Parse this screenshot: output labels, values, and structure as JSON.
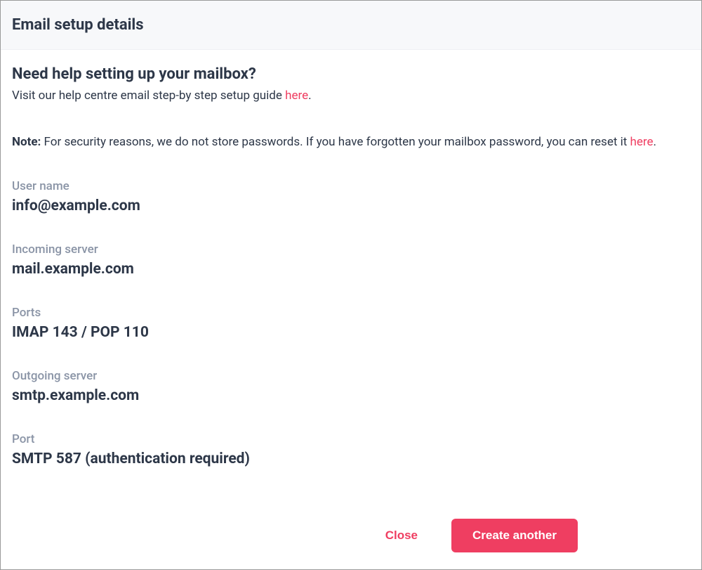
{
  "header": {
    "title": "Email setup details"
  },
  "help": {
    "heading": "Need help setting up your mailbox?",
    "text_before": "Visit our help centre email step-by step setup guide ",
    "link": "here",
    "text_after": "."
  },
  "note": {
    "label": "Note:",
    "text_before": " For security reasons, we do not store passwords. If you have forgotten your mailbox password, you can reset it ",
    "link": "here",
    "text_after": "."
  },
  "fields": {
    "username": {
      "label": "User name",
      "value": "info@example.com"
    },
    "incoming": {
      "label": "Incoming server",
      "value": "mail.example.com"
    },
    "ports_in": {
      "label": "Ports",
      "value": "IMAP 143 / POP 110"
    },
    "outgoing": {
      "label": "Outgoing server",
      "value": "smtp.example.com"
    },
    "port_out": {
      "label": "Port",
      "value": "SMTP 587 (authentication required)"
    }
  },
  "footer": {
    "close": "Close",
    "create_another": "Create another"
  }
}
